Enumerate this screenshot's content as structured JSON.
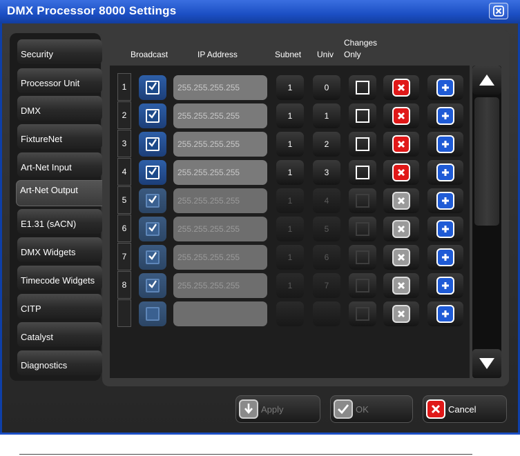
{
  "window": {
    "title": "DMX Processor 8000 Settings"
  },
  "tabs": [
    "Security",
    "Processor Unit",
    "DMX",
    "FixtureNet",
    "Art-Net Input",
    "Art-Net Output",
    "E1.31 (sACN)",
    "DMX Widgets",
    "Timecode Widgets",
    "CITP",
    "Catalyst",
    "Diagnostics"
  ],
  "active_tab": "Art-Net Output",
  "columns": {
    "broadcast": "Broadcast",
    "ip": "IP Address",
    "subnet": "Subnet",
    "univ": "Univ",
    "changes_line1": "Changes",
    "changes_line2": "Only"
  },
  "rows": [
    {
      "num": "1",
      "ip": "255.255.255.255",
      "subnet": "1",
      "univ": "0",
      "enabled": true
    },
    {
      "num": "2",
      "ip": "255.255.255.255",
      "subnet": "1",
      "univ": "1",
      "enabled": true
    },
    {
      "num": "3",
      "ip": "255.255.255.255",
      "subnet": "1",
      "univ": "2",
      "enabled": true
    },
    {
      "num": "4",
      "ip": "255.255.255.255",
      "subnet": "1",
      "univ": "3",
      "enabled": true
    },
    {
      "num": "5",
      "ip": "255.255.255.255",
      "subnet": "1",
      "univ": "4",
      "enabled": false
    },
    {
      "num": "6",
      "ip": "255.255.255.255",
      "subnet": "1",
      "univ": "5",
      "enabled": false
    },
    {
      "num": "7",
      "ip": "255.255.255.255",
      "subnet": "1",
      "univ": "6",
      "enabled": false
    },
    {
      "num": "8",
      "ip": "255.255.255.255",
      "subnet": "1",
      "univ": "7",
      "enabled": false
    }
  ],
  "footer": {
    "apply": "Apply",
    "ok": "OK",
    "cancel": "Cancel"
  },
  "colors": {
    "title_bar": "#1c4fc4",
    "delete_active": "#e01818",
    "add": "#1f5bd6"
  }
}
